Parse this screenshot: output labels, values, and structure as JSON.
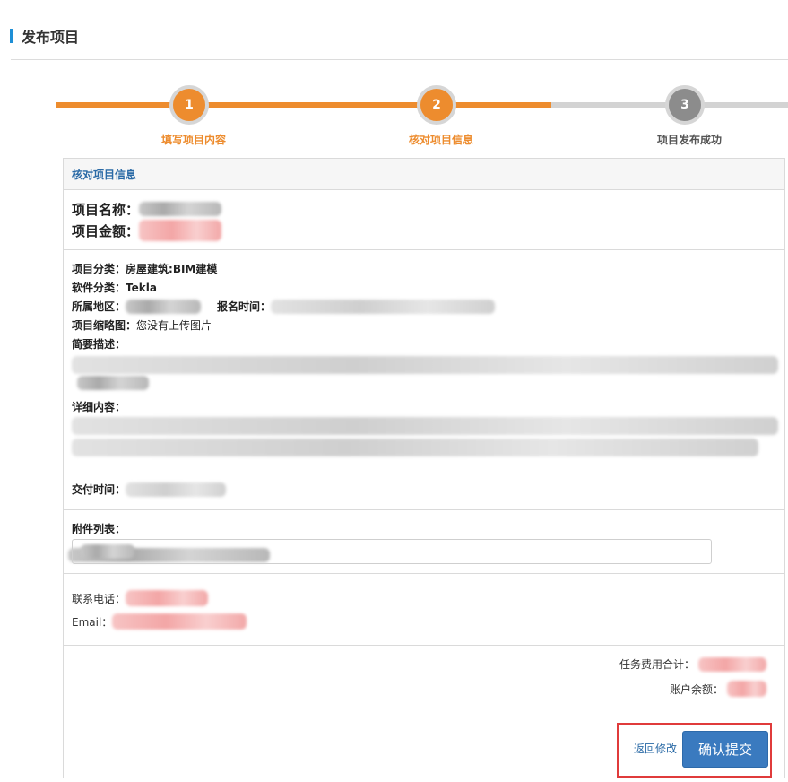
{
  "page": {
    "title": "发布项目"
  },
  "steps": [
    {
      "number": "1",
      "label": "填写项目内容",
      "state": "active"
    },
    {
      "number": "2",
      "label": "核对项目信息",
      "state": "active"
    },
    {
      "number": "3",
      "label": "项目发布成功",
      "state": "pending"
    }
  ],
  "panel": {
    "header": "核对项目信息",
    "project_name_label": "项目名称：",
    "project_amount_label": "项目金额：",
    "category_label": "项目分类：",
    "category_value": "房屋建筑:BIM建模",
    "software_label": "软件分类：",
    "software_value": "Tekla",
    "region_label": "所属地区：",
    "signup_label": "报名时间：",
    "thumbnail_label": "项目缩略图：",
    "thumbnail_value": "您没有上传图片",
    "summary_label": "简要描述：",
    "detail_label": "详细内容：",
    "delivery_label": "交付时间：",
    "attachments_label": "附件列表：",
    "phone_label": "联系电话：",
    "email_label": "Email：",
    "total_fee_label": "任务费用合计：",
    "balance_label": "账户余额："
  },
  "actions": {
    "back_label": "返回修改",
    "confirm_label": "确认提交"
  },
  "colors": {
    "accent_orange": "#ed8c2e",
    "link_blue": "#2a6aa6",
    "button_blue": "#3a7abf",
    "highlight_red": "#e03b3b",
    "title_bar_blue": "#1e8fd6"
  }
}
